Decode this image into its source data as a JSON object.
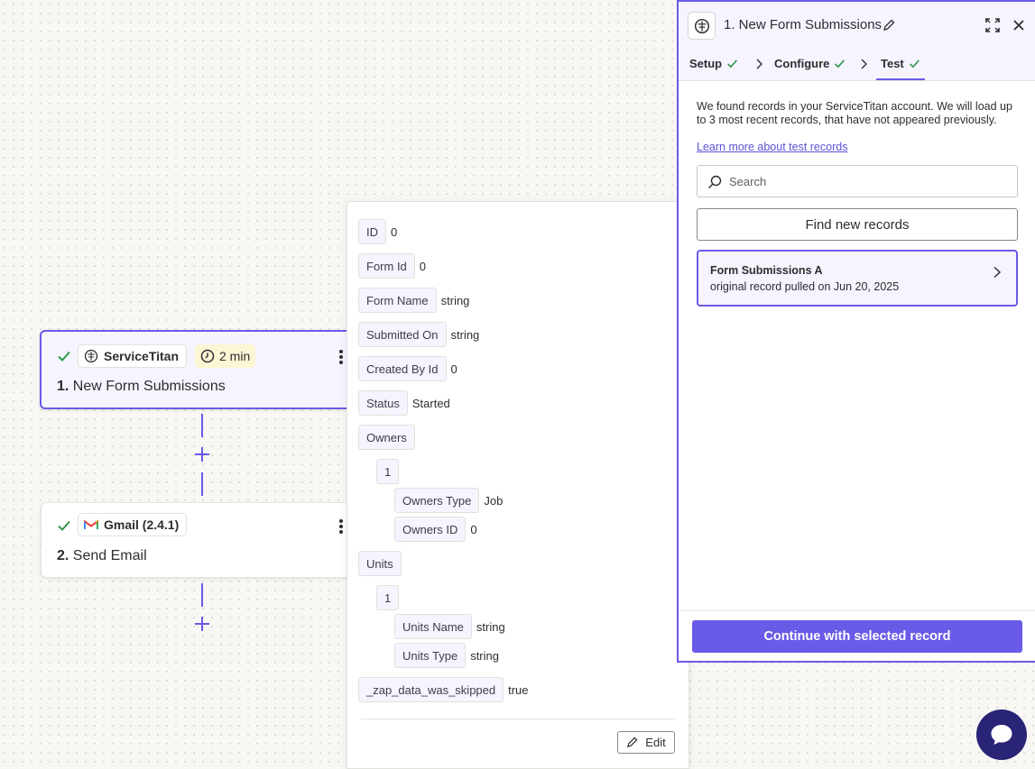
{
  "colors": {
    "accent": "#695be8",
    "accent_light": "#f5f4ff",
    "success": "#2f9b48",
    "chat_bg": "#2a2477"
  },
  "steps": [
    {
      "app_name": "ServiceTitan",
      "icon": "servicetitan-logo-icon",
      "duration": "2 min",
      "number": "1.",
      "title": "New Form Submissions",
      "status": "complete",
      "selected": true
    },
    {
      "app_name": "Gmail (2.4.1)",
      "icon": "gmail-logo-icon",
      "number": "2.",
      "title": "Send Email",
      "status": "complete",
      "selected": false
    }
  ],
  "record_popover": {
    "fields": [
      {
        "key": "ID",
        "value": "0"
      },
      {
        "key": "Form Id",
        "value": "0"
      },
      {
        "key": "Form Name",
        "value": "string"
      },
      {
        "key": "Submitted On",
        "value": "string"
      },
      {
        "key": "Created By Id",
        "value": "0"
      },
      {
        "key": "Status",
        "value": "Started"
      },
      {
        "key": "Owners",
        "value": ""
      },
      {
        "key": "1",
        "value": ""
      },
      {
        "key": "Owners Type",
        "value": "Job"
      },
      {
        "key": "Owners ID",
        "value": "0"
      },
      {
        "key": "Units",
        "value": ""
      },
      {
        "key": "1",
        "value": ""
      },
      {
        "key": "Units Name",
        "value": "string"
      },
      {
        "key": "Units Type",
        "value": "string"
      },
      {
        "key": "_zap_data_was_skipped",
        "value": "true"
      }
    ],
    "edit_label": "Edit"
  },
  "panel": {
    "title": "1. New Form Submissions",
    "tabs": [
      {
        "label": "Setup",
        "status": "complete"
      },
      {
        "label": "Configure",
        "status": "complete"
      },
      {
        "label": "Test",
        "status": "complete",
        "active": true
      }
    ],
    "intro": "We found records in your ServiceTitan account. We will load up to 3 most recent records, that have not appeared previously.",
    "learn_link": "Learn more about test records",
    "search_placeholder": "Search",
    "find_button": "Find new records",
    "record": {
      "title": "Form Submissions A",
      "subtitle": "original record pulled on Jun 20, 2025"
    },
    "continue_button": "Continue with selected record"
  }
}
